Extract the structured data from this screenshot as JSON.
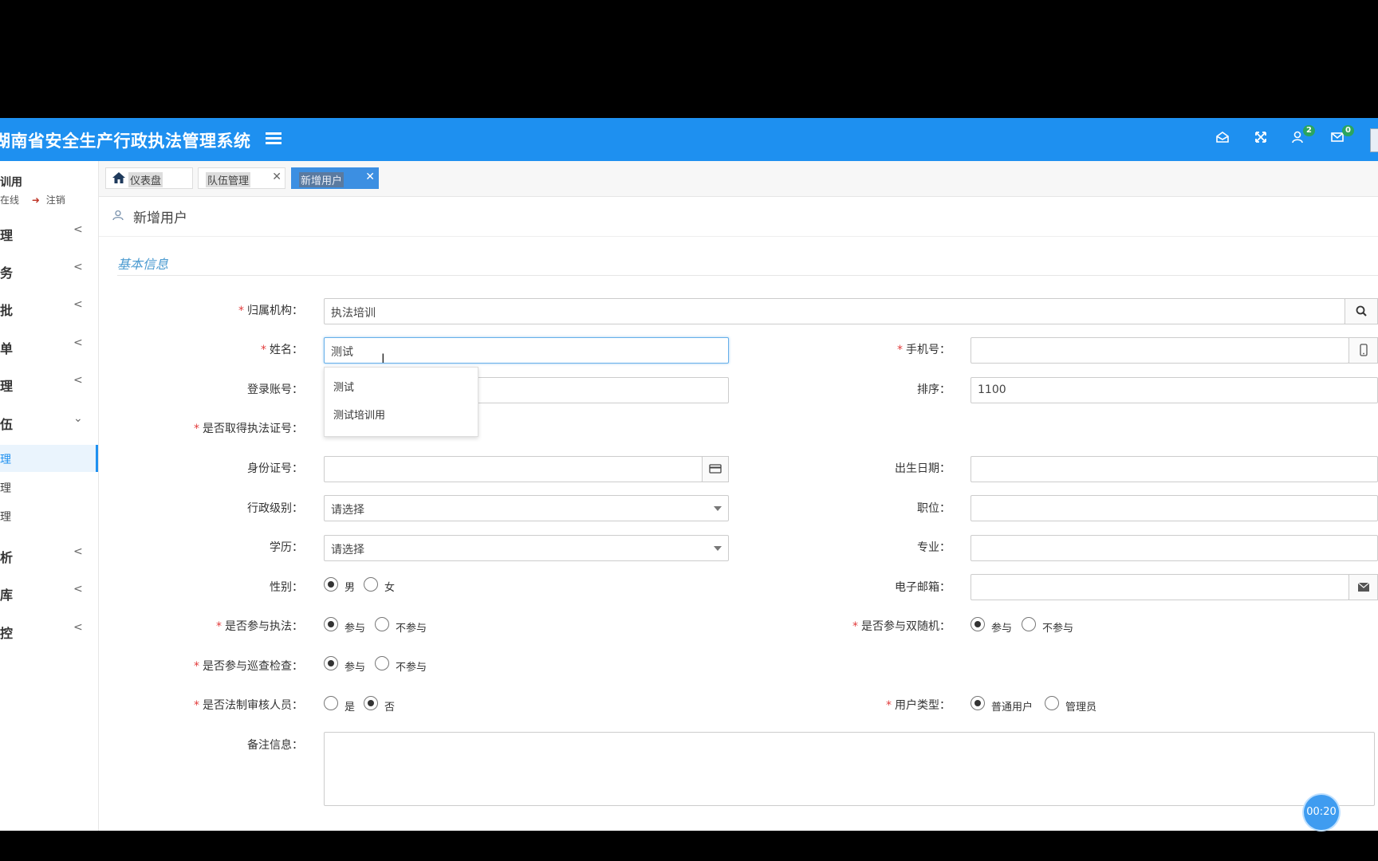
{
  "app": {
    "title": "湖南省安全生产行政执法管理系统"
  },
  "topbar": {
    "icons": [
      "message-icon",
      "fullscreen-icon",
      "user-notify-icon",
      "mail-icon"
    ],
    "user_badge": "2",
    "mail_badge": "0"
  },
  "sidebar": {
    "user_name": "训用",
    "status_online": "在线",
    "logout_label": "注销",
    "nav": [
      {
        "label": "理"
      },
      {
        "label": "务"
      },
      {
        "label": "批"
      },
      {
        "label": "单"
      },
      {
        "label": "理"
      },
      {
        "label": "伍"
      },
      {
        "label": "析"
      },
      {
        "label": "库"
      },
      {
        "label": "控"
      }
    ],
    "sub": [
      {
        "label": "理"
      },
      {
        "label": "理"
      },
      {
        "label": "理"
      }
    ]
  },
  "tabs": [
    {
      "label": "仪表盘"
    },
    {
      "label": "队伍管理"
    },
    {
      "label": "新增用户"
    }
  ],
  "page": {
    "title": "新增用户",
    "section": "基本信息"
  },
  "form": {
    "org_label": "归属机构：",
    "org_value": "执法培训",
    "name_label": "姓名：",
    "name_value": "测试",
    "phone_label": "手机号：",
    "account_label": "登录账号：",
    "sort_label": "排序：",
    "sort_value": "1100",
    "cert_label": "是否取得执法证号：",
    "idcard_label": "身份证号：",
    "birth_label": "出生日期：",
    "admin_level_label": "行政级别：",
    "admin_level_value": "请选择",
    "position_label": "职位：",
    "edu_label": "学历：",
    "edu_value": "请选择",
    "major_label": "专业：",
    "gender_label": "性别：",
    "gender_male": "男",
    "gender_female": "女",
    "email_label": "电子邮箱：",
    "enforce_label": "是否参与执法：",
    "join": "参与",
    "not_join": "不参与",
    "dual_label": "是否参与双随机：",
    "patrol_label": "是否参与巡查检查：",
    "legal_label": "是否法制审核人员：",
    "yes": "是",
    "no": "否",
    "user_type_label": "用户类型：",
    "user_type_normal": "普通用户",
    "user_type_admin": "管理员",
    "remark_label": "备注信息："
  },
  "autocomplete": [
    "测试",
    "测试培训用"
  ],
  "timer": "00:20"
}
